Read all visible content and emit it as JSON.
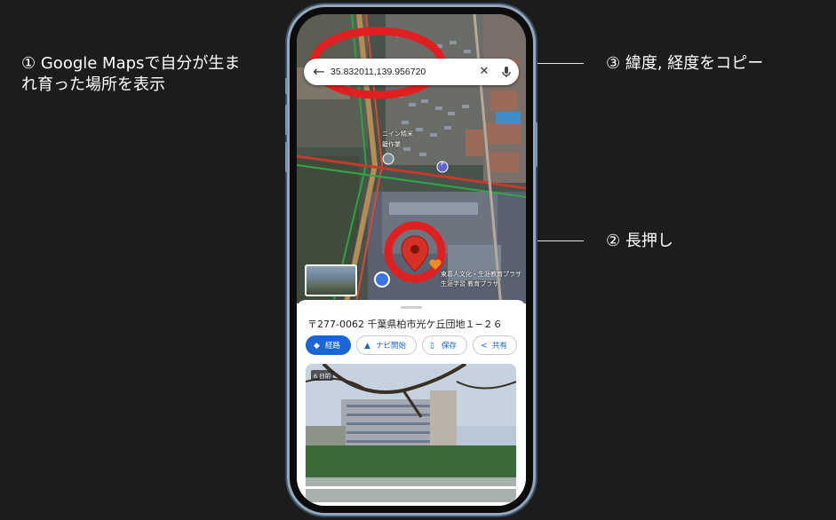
{
  "annotations": {
    "step1": "① Google Mapsで自分が生まれ育った場所を表示",
    "step2": "② 長押し",
    "step3": "③ 緯度, 経度をコピー"
  },
  "search": {
    "query": "35.832011,139.956720",
    "back_icon": "arrow-left-icon",
    "clear_icon": "close-icon",
    "mic_icon": "microphone-icon"
  },
  "map": {
    "labels": [
      "ニイン精米",
      "籠作業",
      "P",
      "東葛人文化・生涯教育プラザ",
      "生涯学習 教育プラザ"
    ]
  },
  "place": {
    "address": "〒277-0062 千葉県柏市光ケ丘団地１−２６"
  },
  "actions": [
    {
      "label": "経路",
      "icon": "directions-icon",
      "primary": true
    },
    {
      "label": "ナビ開始",
      "icon": "navigation-icon",
      "primary": false
    },
    {
      "label": "保存",
      "icon": "bookmark-icon",
      "primary": false
    },
    {
      "label": "共有",
      "icon": "share-icon",
      "primary": false
    }
  ],
  "photo": {
    "badge": "6 日前"
  },
  "colors": {
    "background": "#1c1c1c",
    "pin": "#d93025",
    "highlight": "#e02020",
    "primary_button": "#1a66d2",
    "phone_frame": "#93a7bd"
  }
}
